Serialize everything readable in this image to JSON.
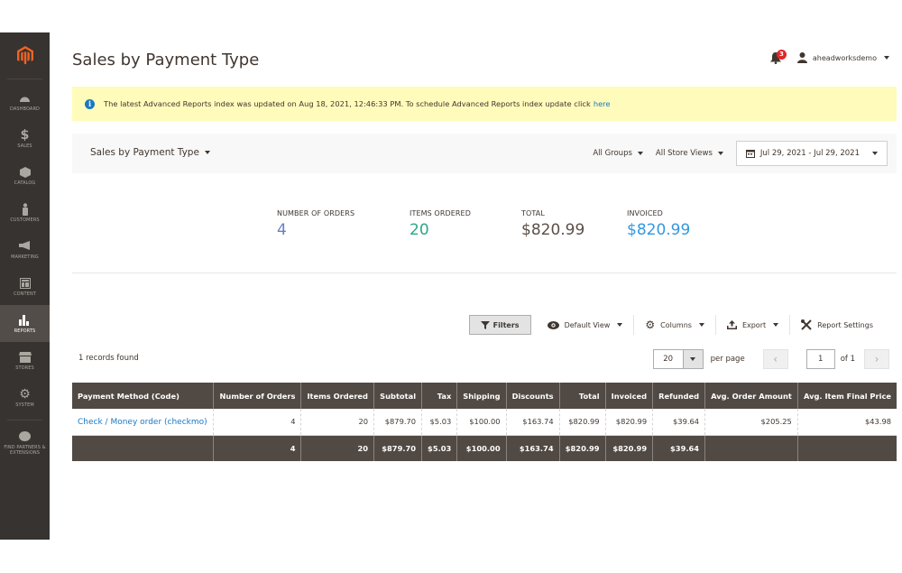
{
  "sidebar": {
    "items": [
      {
        "label": "Dashboard",
        "icon": "dashboard-icon"
      },
      {
        "label": "Sales",
        "icon": "dollar-icon"
      },
      {
        "label": "Catalog",
        "icon": "box-icon"
      },
      {
        "label": "Customers",
        "icon": "person-icon"
      },
      {
        "label": "Marketing",
        "icon": "megaphone-icon"
      },
      {
        "label": "Content",
        "icon": "layout-icon"
      },
      {
        "label": "Reports",
        "icon": "bar-chart-icon",
        "active": true
      },
      {
        "label": "Stores",
        "icon": "store-icon"
      },
      {
        "label": "System",
        "icon": "gear-icon"
      },
      {
        "label": "Find Partners & Extensions",
        "icon": "partners-icon"
      }
    ]
  },
  "header": {
    "title": "Sales by Payment Type",
    "notifications_count": "3",
    "username": "aheadworksdemo"
  },
  "notice": {
    "text": "The latest Advanced Reports index was updated on Aug 18, 2021, 12:46:33 PM. To schedule Advanced Reports index update click",
    "link": "here"
  },
  "toolbar": {
    "report_select": "Sales by Payment Type",
    "customer_group": "All Groups",
    "store_view": "All Store Views",
    "date_range": "Jul 29, 2021 - Jul 29, 2021"
  },
  "stats": [
    {
      "title": "Number of Orders",
      "value": "4",
      "color": "#6b7fc1"
    },
    {
      "title": "Items Ordered",
      "value": "20",
      "color": "#2fa68a"
    },
    {
      "title": "Total",
      "value": "$820.99",
      "color": "#5b4f48"
    },
    {
      "title": "Invoiced",
      "value": "$820.99",
      "color": "#3398e0"
    }
  ],
  "grid_actions": {
    "filters": "Filters",
    "view": "Default View",
    "columns": "Columns",
    "export": "Export",
    "settings": "Report Settings"
  },
  "records_found": "1 records found",
  "pager": {
    "per_page_value": "20",
    "per_page_label": "per page",
    "current_page": "1",
    "of_label": "of 1"
  },
  "table": {
    "columns": [
      "Payment Method (Code)",
      "Number of Orders",
      "Items Ordered",
      "Subtotal",
      "Tax",
      "Shipping",
      "Discounts",
      "Total",
      "Invoiced",
      "Refunded",
      "Avg. Order Amount",
      "Avg. Item Final Price"
    ],
    "rows": [
      [
        "Check / Money order (checkmo)",
        "4",
        "20",
        "$879.70",
        "$5.03",
        "$100.00",
        "$163.74",
        "$820.99",
        "$820.99",
        "$39.64",
        "$205.25",
        "$43.98"
      ]
    ],
    "totals": [
      "",
      "4",
      "20",
      "$879.70",
      "$5.03",
      "$100.00",
      "$163.74",
      "$820.99",
      "$820.99",
      "$39.64",
      "",
      ""
    ]
  }
}
